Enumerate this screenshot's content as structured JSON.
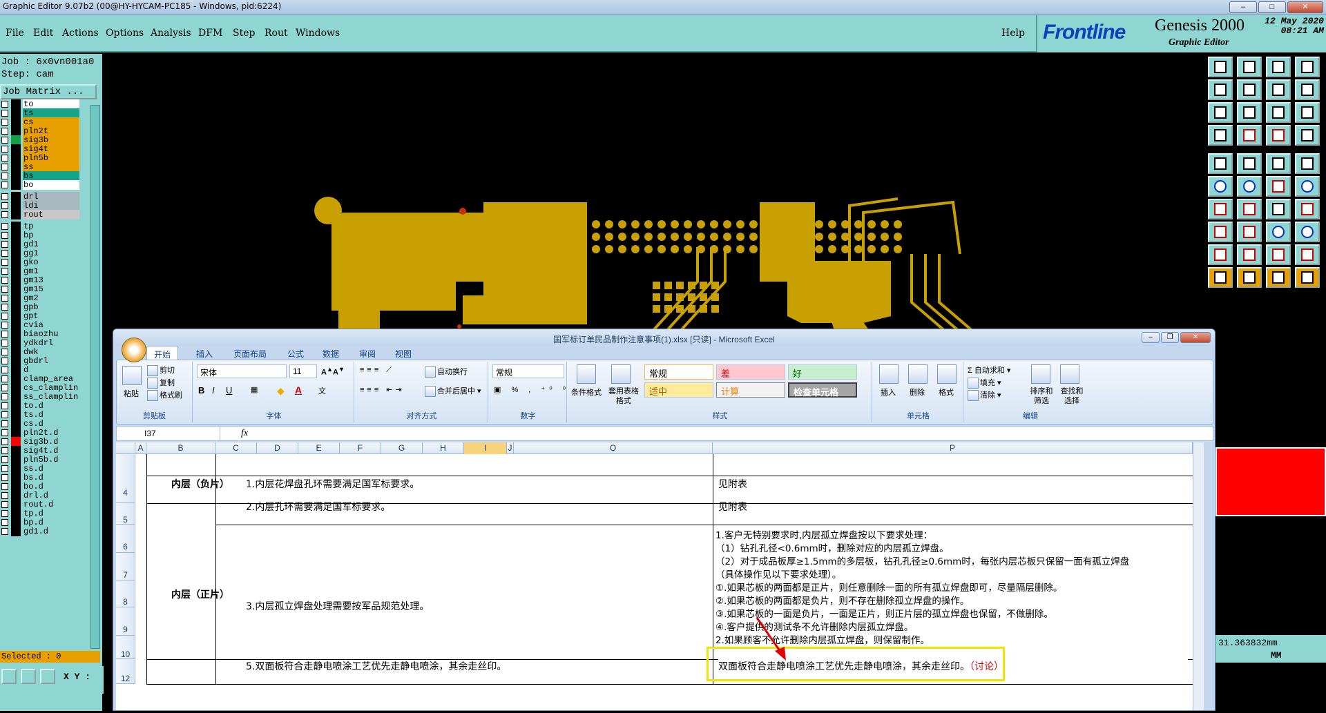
{
  "window": {
    "title": "Graphic Editor 9.07b2 (00@HY-HYCAM-PC185 - Windows, pid:6224)"
  },
  "menu": [
    "File",
    "Edit",
    "Actions",
    "Options",
    "Analysis",
    "DFM",
    "Step",
    "Rout",
    "Windows"
  ],
  "help": "Help",
  "brand": {
    "logo": "Frontline",
    "product": "Genesis 2000",
    "sub": "Graphic Editor",
    "date": "12 May 2020",
    "time": "08:21 AM"
  },
  "job": {
    "job_line": "Job : 6x0vn001a0",
    "step_line": "Step: cam",
    "matrix": "Job Matrix ..."
  },
  "layers": [
    {
      "name": "to",
      "color": "#ffffff"
    },
    {
      "name": "ts",
      "color": "#14a48a"
    },
    {
      "name": "cs",
      "color": "#e8a000"
    },
    {
      "name": "pln2t",
      "color": "#e8a000"
    },
    {
      "name": "sig3b",
      "color": "#e8a000"
    },
    {
      "name": "sig4t",
      "color": "#e8a000"
    },
    {
      "name": "pln5b",
      "color": "#e8a000"
    },
    {
      "name": "ss",
      "color": "#e8a000"
    },
    {
      "name": "bs",
      "color": "#14a48a"
    },
    {
      "name": "bo",
      "color": "#ffffff"
    },
    {
      "name": "drl",
      "color": "#a9b9c0"
    },
    {
      "name": "ldi",
      "color": "#a9b9c0"
    },
    {
      "name": "rout",
      "color": "#c8c8c8"
    },
    {
      "name": "tp",
      "color": "#8fd6d3"
    },
    {
      "name": "bp",
      "color": "#8fd6d3"
    },
    {
      "name": "gd1",
      "color": "#8fd6d3"
    },
    {
      "name": "gg1",
      "color": "#8fd6d3"
    },
    {
      "name": "gko",
      "color": "#8fd6d3"
    },
    {
      "name": "gm1",
      "color": "#8fd6d3"
    },
    {
      "name": "gm13",
      "color": "#8fd6d3"
    },
    {
      "name": "gm15",
      "color": "#8fd6d3"
    },
    {
      "name": "gm2",
      "color": "#8fd6d3"
    },
    {
      "name": "gpb",
      "color": "#8fd6d3"
    },
    {
      "name": "gpt",
      "color": "#8fd6d3"
    },
    {
      "name": "cvia",
      "color": "#8fd6d3"
    },
    {
      "name": "biaozhu",
      "color": "#8fd6d3"
    },
    {
      "name": "ydkdrl",
      "color": "#8fd6d3"
    },
    {
      "name": "dwk",
      "color": "#8fd6d3"
    },
    {
      "name": "gbdrl",
      "color": "#8fd6d3"
    },
    {
      "name": "d",
      "color": "#8fd6d3"
    },
    {
      "name": "clamp_area",
      "color": "#8fd6d3"
    },
    {
      "name": "cs_clamplin",
      "color": "#8fd6d3"
    },
    {
      "name": "ss_clamplin",
      "color": "#8fd6d3"
    },
    {
      "name": "to.d",
      "color": "#8fd6d3"
    },
    {
      "name": "ts.d",
      "color": "#8fd6d3"
    },
    {
      "name": "cs.d",
      "color": "#8fd6d3"
    },
    {
      "name": "pln2t.d",
      "color": "#8fd6d3"
    },
    {
      "name": "sig3b.d",
      "color": "#8fd6d3"
    },
    {
      "name": "sig4t.d",
      "color": "#8fd6d3"
    },
    {
      "name": "pln5b.d",
      "color": "#8fd6d3"
    },
    {
      "name": "ss.d",
      "color": "#8fd6d3"
    },
    {
      "name": "bs.d",
      "color": "#8fd6d3"
    },
    {
      "name": "bo.d",
      "color": "#8fd6d3"
    },
    {
      "name": "drl.d",
      "color": "#8fd6d3"
    },
    {
      "name": "rout.d",
      "color": "#8fd6d3"
    },
    {
      "name": "tp.d",
      "color": "#8fd6d3"
    },
    {
      "name": "bp.d",
      "color": "#8fd6d3"
    },
    {
      "name": "gd1.d",
      "color": "#8fd6d3"
    }
  ],
  "selected": "Selected : 0",
  "xy_label": "X Y :",
  "coord": {
    "value": "31.363832mm",
    "unit": "MM"
  },
  "excel": {
    "title": "国军标订单民品制作注意事项(1).xlsx  [只读]  -  Microsoft Excel",
    "tabs": [
      "开始",
      "插入",
      "页面布局",
      "公式",
      "数据",
      "审阅",
      "视图"
    ],
    "clipboard": {
      "paste": "粘贴",
      "cut": "剪切",
      "copy": "复制",
      "format_painter": "格式刷",
      "label": "剪贴板"
    },
    "font": {
      "name": "宋体",
      "size": "11",
      "label": "字体"
    },
    "align": {
      "wrap": "自动换行",
      "merge": "合并后居中",
      "label": "对齐方式"
    },
    "number": {
      "format": "常规",
      "label": "数字"
    },
    "styles": {
      "cond": "条件格式",
      "table": "套用表格格式",
      "normal": "常规",
      "bad": "差",
      "good": "好",
      "neutral": "适中",
      "calc": "计算",
      "check": "检查单元格",
      "label": "样式"
    },
    "cells": {
      "insert": "插入",
      "delete": "删除",
      "format": "格式",
      "label": "单元格"
    },
    "edit": {
      "autosum": "自动求和",
      "fill": "填充",
      "clear": "清除",
      "sort": "排序和筛选",
      "find": "查找和选择",
      "label": "编辑"
    },
    "namebox": "I37",
    "fx": "fx",
    "columns": [
      "A",
      "B",
      "C",
      "D",
      "E",
      "F",
      "G",
      "H",
      "I",
      "J",
      "O",
      "P"
    ],
    "rows": [
      "4",
      "5",
      "6",
      "7",
      "8",
      "9",
      "10",
      "12"
    ],
    "b_neg": "内层（负片）",
    "b_pos": "内层（正片）",
    "c4": "1.内层花焊盘孔环需要满足国军标要求。",
    "c5": "2.内层孔环需要满足国军标要求。",
    "c8": "3.内层孤立焊盘处理需要按军品规范处理。",
    "c12": "5.双面板符合走静电喷涂工艺优先走静电喷涂，其余走丝印。",
    "p4": "见附表",
    "p5": "见附表",
    "p_lines": [
      "1.客户无特别要求时,内层孤立焊盘按以下要求处理：",
      "（1）钻孔孔径<0.6mm时，删除对应的内层孤立焊盘。",
      "（2）对于成品板厚≥1.5mm的多层板，钻孔孔径≥0.6mm时，每张内层芯板只保留一面有孤立焊盘",
      "（具体操作见以下要求处理）。",
      "①.如果芯板的两面都是正片，则任意删除一面的所有孤立焊盘即可，尽量隔层删除。",
      "②.如果芯板的两面都是负片，则不存在删除孤立焊盘的操作。",
      "③.如果芯板的一面是负片，一面是正片，则正片层的孤立焊盘也保留，不做删除。",
      "④.客户提供的测试条不允许删除内层孤立焊盘。",
      "2.如果顾客不允许删除内层孤立焊盘，则保留制作。"
    ],
    "p12": "双面板符合走静电喷涂工艺优先走静电喷涂，其余走丝印。",
    "p12_note": "（讨论）"
  }
}
